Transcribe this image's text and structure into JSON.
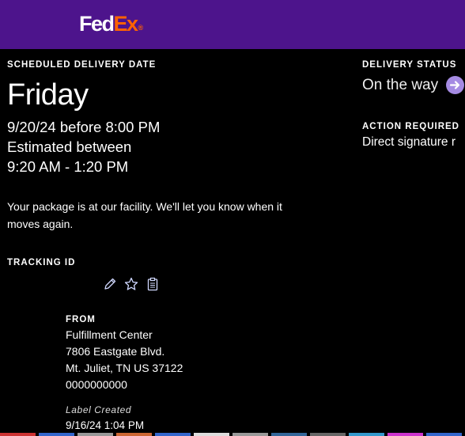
{
  "header": {
    "logo_part1": "Fed",
    "logo_part2": "Ex",
    "logo_dot": "®",
    "brand_purple": "#4d148c",
    "brand_orange": "#ff6200"
  },
  "delivery": {
    "date_label": "SCHEDULED DELIVERY DATE",
    "day": "Friday",
    "date_line": "9/20/24 before 8:00 PM",
    "estimate_label": "Estimated between",
    "estimate_window": "9:20 AM - 1:20 PM",
    "message": "Your package is at our facility. We'll let you know when it moves again."
  },
  "status": {
    "label": "DELIVERY STATUS",
    "value": "On the way",
    "action_label": "ACTION REQUIRED",
    "action_value": "Direct signature r",
    "arrow_icon": "arrow-right-circle-icon"
  },
  "tracking": {
    "label": "TRACKING ID",
    "icons": [
      "pencil-icon",
      "star-icon",
      "clipboard-icon"
    ]
  },
  "from": {
    "label": "FROM",
    "name": "Fulfillment Center",
    "street": "7806 Eastgate Blvd.",
    "city": "Mt. Juliet, TN US 37122",
    "phone": "0000000000"
  },
  "event": {
    "label": "Label Created",
    "date": "9/16/24 1:04 PM"
  }
}
